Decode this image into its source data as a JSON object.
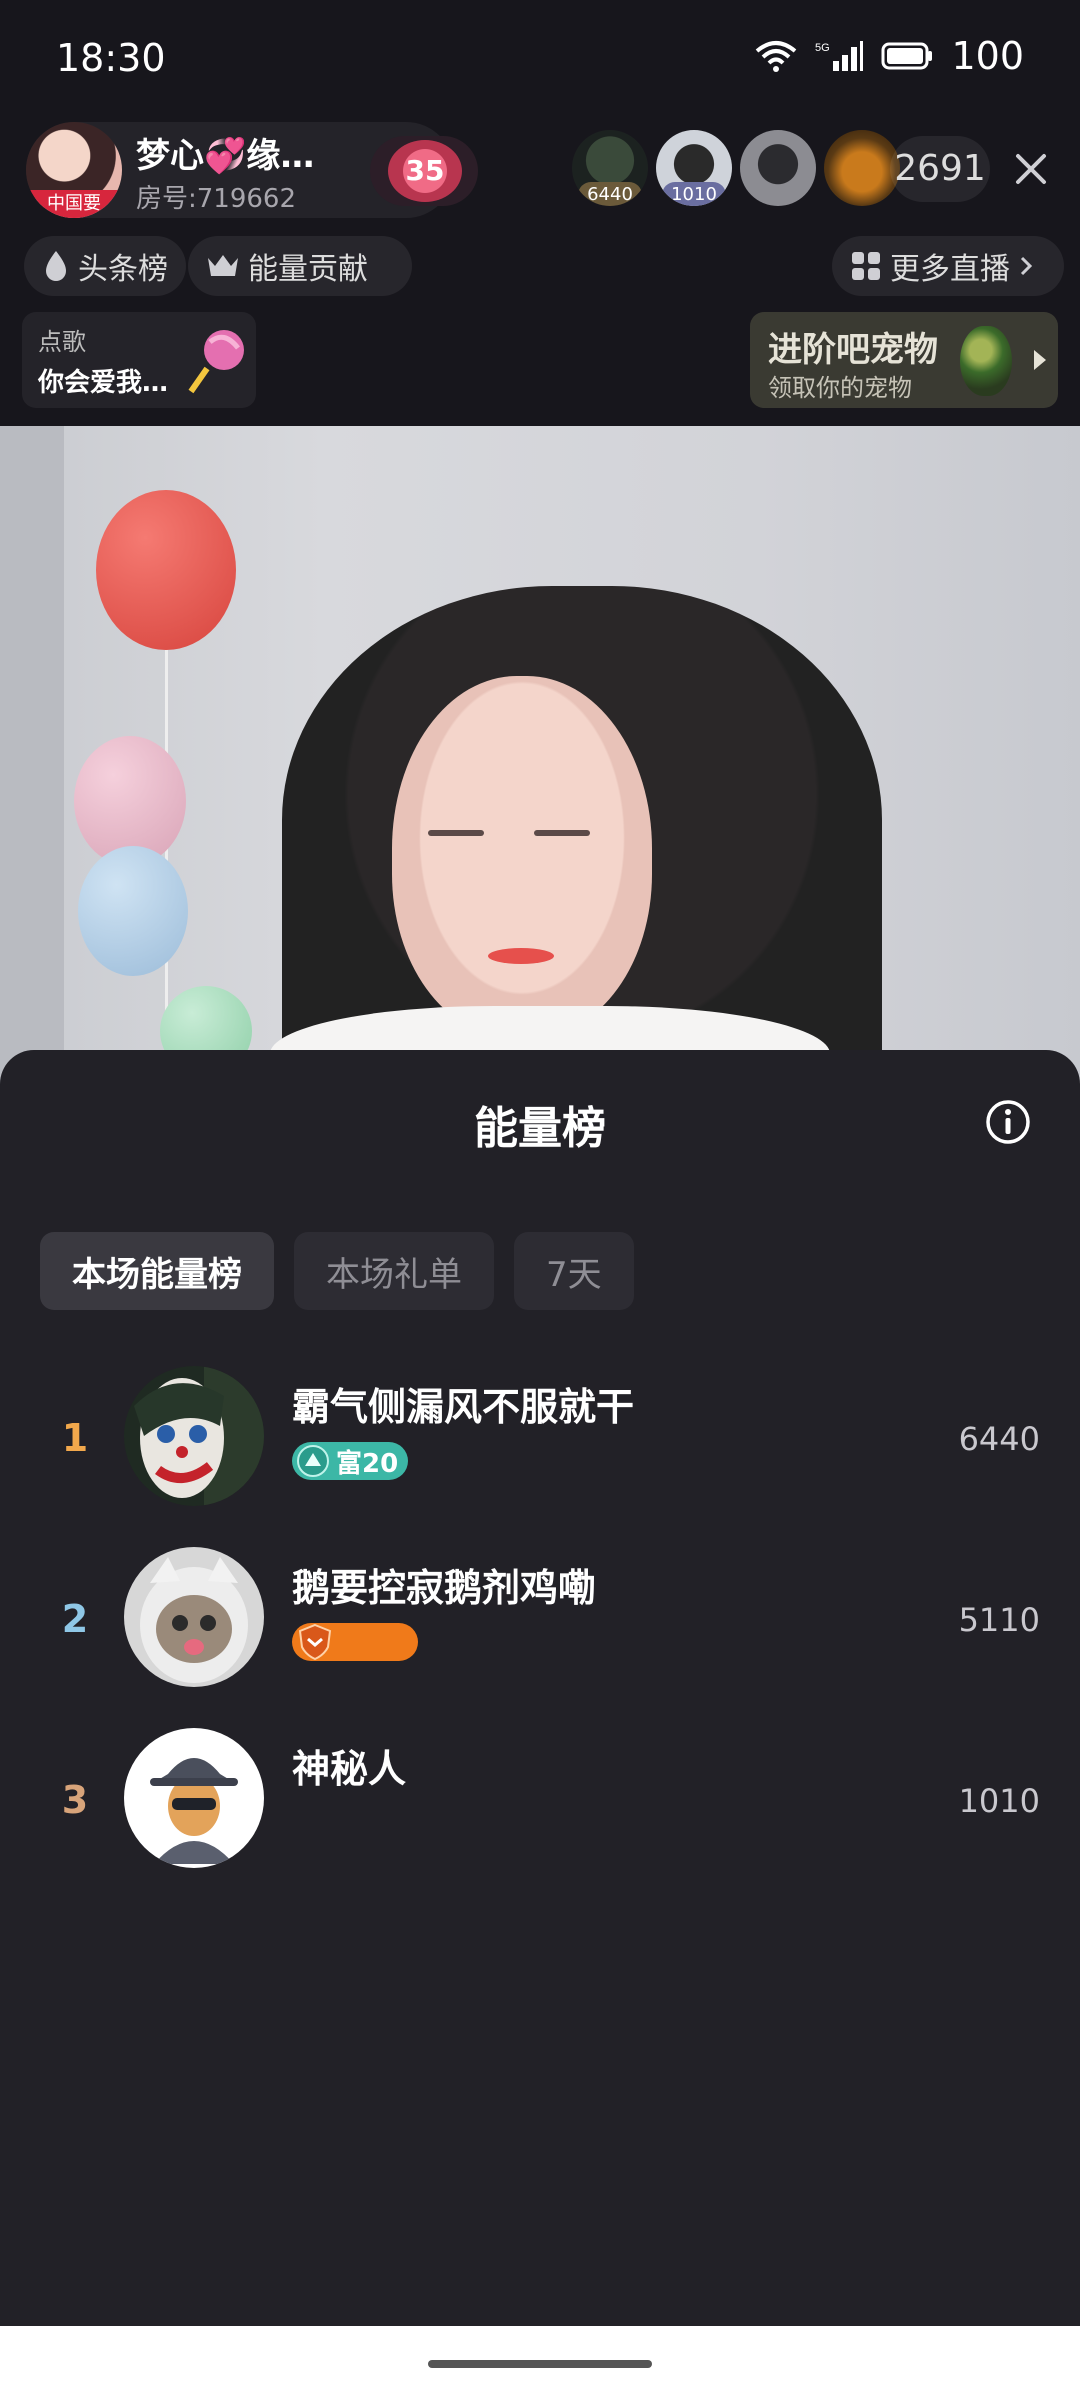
{
  "status_bar": {
    "time": "18:30",
    "network": "5G",
    "battery": "100"
  },
  "host": {
    "name": "梦心💞缘…",
    "room": "房号:719662",
    "avatar_tag": "中国要",
    "level": "35"
  },
  "viewers": [
    {
      "badge": "6440",
      "badge_color": "#6b5a3a"
    },
    {
      "badge": "1010",
      "badge_color": "#5a5a8a"
    },
    {
      "badge": "",
      "badge_color": ""
    },
    {
      "badge": "",
      "badge_color": ""
    }
  ],
  "viewer_count": "2691",
  "pills": {
    "headline": "头条榜",
    "energy": "能量贡献",
    "more_live": "更多直播"
  },
  "song": {
    "label": "点歌",
    "title": "你会爱我…"
  },
  "pet": {
    "title": "进阶吧宠物",
    "subtitle": "领取你的宠物"
  },
  "sheet": {
    "title": "能量榜",
    "tabs": [
      {
        "label": "本场能量榜",
        "active": true
      },
      {
        "label": "本场礼单",
        "active": false
      },
      {
        "label": "7天",
        "active": false
      }
    ],
    "ranks": [
      {
        "rank": "1",
        "rank_color": "#f2a84c",
        "name": "霸气侧漏风不服就干",
        "badge": "富20",
        "badge_color": "#3cb7a6",
        "score": "6440"
      },
      {
        "rank": "2",
        "rank_color": "#8fc7e6",
        "name": "鹅要控寂鹅剂鸡嘞",
        "badge": "",
        "badge_color": "#f07a1a",
        "score": "5110"
      },
      {
        "rank": "3",
        "rank_color": "#d8a47a",
        "name": "神秘人",
        "badge": "",
        "badge_color": "",
        "score": "1010"
      }
    ]
  },
  "colors": {
    "background": "#17161c",
    "sheet": "#222127",
    "accent_gold": "#f2a84c"
  }
}
